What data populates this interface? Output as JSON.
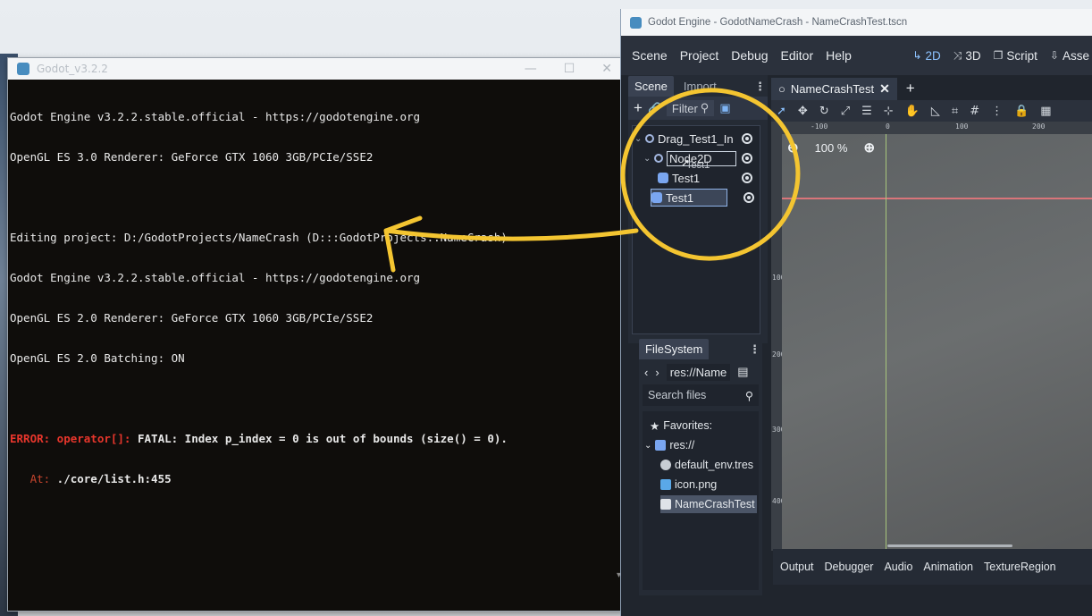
{
  "console": {
    "title": "Godot_v3.2.2",
    "lines": [
      "Godot Engine v3.2.2.stable.official - https://godotengine.org",
      "OpenGL ES 3.0 Renderer: GeForce GTX 1060 3GB/PCIe/SSE2",
      "",
      "Editing project: D:/GodotProjects/NameCrash (D:::GodotProjects::NameCrash)",
      "Godot Engine v3.2.2.stable.official - https://godotengine.org",
      "OpenGL ES 2.0 Renderer: GeForce GTX 1060 3GB/PCIe/SSE2",
      "OpenGL ES 2.0 Batching: ON",
      ""
    ],
    "error_label": "ERROR: operator[]:",
    "error_message": " FATAL: Index p_index = 0 is out of bounds (size() = 0).",
    "at_label": "   At:",
    "at_path": " ./core/list.h:455"
  },
  "editor": {
    "title": "Godot Engine - GodotNameCrash - NameCrashTest.tscn",
    "menu": [
      "Scene",
      "Project",
      "Debug",
      "Editor",
      "Help"
    ],
    "modes": [
      {
        "icon": "↳",
        "label": "2D",
        "active": true
      },
      {
        "icon": "⤨",
        "label": "3D",
        "active": false
      },
      {
        "icon": "❐",
        "label": "Script",
        "active": false
      },
      {
        "icon": "⇩",
        "label": "Asse",
        "active": false
      }
    ],
    "scene_dock": {
      "tabs": [
        "Scene",
        "Import"
      ],
      "filter_label": "Filter",
      "tree": [
        {
          "label": "Drag_Test1_In",
          "type": "node",
          "level": 0
        },
        {
          "label": "Node2D",
          "type": "node",
          "level": 1,
          "renaming": true
        },
        {
          "label": "Test1",
          "type": "sprite",
          "level": 2
        },
        {
          "label": "Test1",
          "type": "sprite",
          "level": 2,
          "selected": true
        }
      ],
      "drag_ghost_label": "Test1"
    },
    "filesystem_dock": {
      "tab": "FileSystem",
      "path": "res://Name",
      "search_placeholder": "Search files",
      "favorites_label": "Favorites:",
      "root_label": "res://",
      "files": [
        {
          "label": "default_env.tres",
          "icon": "globe-icon"
        },
        {
          "label": "icon.png",
          "icon": "image-icon"
        },
        {
          "label": "NameCrashTest",
          "icon": "scene-icon",
          "selected": true
        }
      ]
    },
    "viewport": {
      "tab_label": "NameCrashTest",
      "zoom_label": "100 %",
      "ruler_top": [
        "-100",
        "0",
        "100",
        "200"
      ],
      "ruler_left": [
        "100",
        "200",
        "300",
        "400"
      ]
    },
    "bottom_tabs": [
      "Output",
      "Debugger",
      "Audio",
      "Animation",
      "TextureRegion"
    ]
  },
  "colors": {
    "annotation": "#f4c531",
    "error": "#e8362c",
    "accent": "#8dc3ff"
  }
}
